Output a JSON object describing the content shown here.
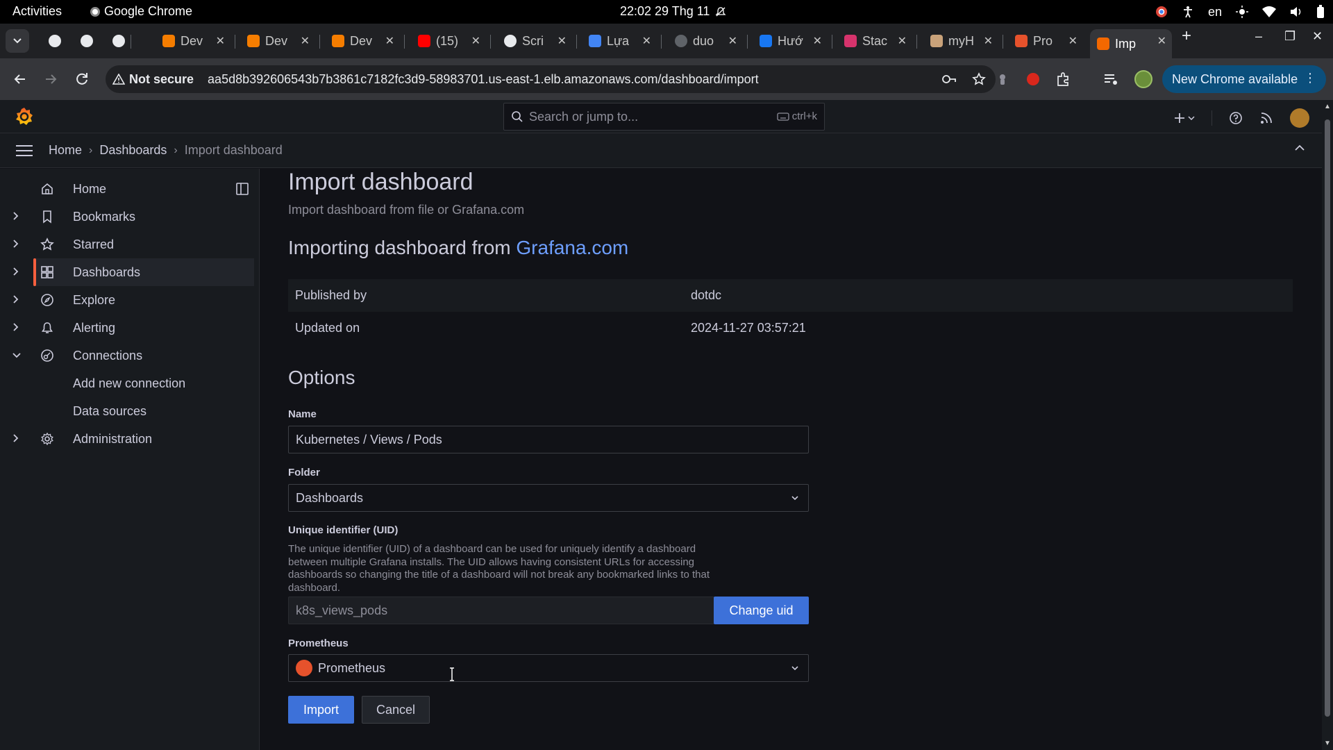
{
  "os_bar": {
    "activities": "Activities",
    "app_name": "Google Chrome",
    "clock": "22:02  29 Thg 11",
    "lang": "en"
  },
  "tabs": [
    {
      "label": "",
      "icon": "openai-icon"
    },
    {
      "label": "",
      "icon": "github-icon"
    },
    {
      "label": "",
      "icon": "openai-icon"
    },
    {
      "label": "Dev",
      "icon": "blogger-icon"
    },
    {
      "label": "Dev",
      "icon": "blogger-icon"
    },
    {
      "label": "Dev",
      "icon": "blogger-icon"
    },
    {
      "label": "(15)",
      "icon": "youtube-icon"
    },
    {
      "label": "Scri",
      "icon": "github-icon"
    },
    {
      "label": "Lựa",
      "icon": "docs-icon"
    },
    {
      "label": "duo",
      "icon": "loading-icon"
    },
    {
      "label": "Hướ",
      "icon": "facebook-icon"
    },
    {
      "label": "Stac",
      "icon": "stack-icon"
    },
    {
      "label": "myH",
      "icon": "avatar-icon"
    },
    {
      "label": "Pro",
      "icon": "prometheus-icon"
    },
    {
      "label": "Imp",
      "icon": "grafana-icon"
    }
  ],
  "toolbar": {
    "security": "Not secure",
    "url": "aa5d8b392606543b7b3861c7182fc3d9-58983701.us-east-1.elb.amazonaws.com/dashboard/import",
    "new_chrome": "New Chrome available"
  },
  "grafana": {
    "search_placeholder": "Search or jump to...",
    "search_shortcut": "ctrl+k",
    "breadcrumb": [
      "Home",
      "Dashboards",
      "Import dashboard"
    ]
  },
  "sidebar": {
    "items": [
      {
        "label": "Home",
        "icon": "home-icon"
      },
      {
        "label": "Bookmarks",
        "icon": "bookmark-icon"
      },
      {
        "label": "Starred",
        "icon": "star-icon"
      },
      {
        "label": "Dashboards",
        "icon": "dashboards-icon"
      },
      {
        "label": "Explore",
        "icon": "compass-icon"
      },
      {
        "label": "Alerting",
        "icon": "bell-icon"
      },
      {
        "label": "Connections",
        "icon": "connections-icon"
      },
      {
        "label": "Add new connection",
        "icon": ""
      },
      {
        "label": "Data sources",
        "icon": ""
      },
      {
        "label": "Administration",
        "icon": "gear-icon"
      }
    ],
    "active": "Dashboards"
  },
  "main": {
    "title": "Import dashboard",
    "subtitle": "Import dashboard from file or Grafana.com",
    "importing_prefix": "Importing dashboard from ",
    "importing_link": "Grafana.com",
    "info": [
      {
        "key": "Published by",
        "value": "dotdc"
      },
      {
        "key": "Updated on",
        "value": "2024-11-27 03:57:21"
      }
    ],
    "options_heading": "Options",
    "name_label": "Name",
    "name_value": "Kubernetes / Views / Pods",
    "folder_label": "Folder",
    "folder_value": "Dashboards",
    "uid_label": "Unique identifier (UID)",
    "uid_description": "The unique identifier (UID) of a dashboard can be used for uniquely identify a dashboard between multiple Grafana installs. The UID allows having consistent URLs for accessing dashboards so changing the title of a dashboard will not break any bookmarked links to that dashboard.",
    "uid_value": "k8s_views_pods",
    "change_uid": "Change uid",
    "prometheus_label": "Prometheus",
    "prometheus_value": "Prometheus",
    "import_button": "Import",
    "cancel_button": "Cancel"
  },
  "colors": {
    "accent": "#3d71d9",
    "link": "#6e9fff",
    "active_bar": "#f55f3e",
    "prometheus": "#e6522c"
  }
}
